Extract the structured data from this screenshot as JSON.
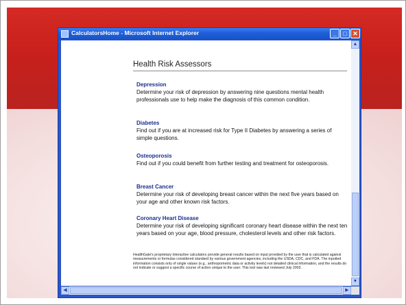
{
  "window": {
    "title": "CalculatorsHome - Microsoft Internet Explorer",
    "minimize_glyph": "_",
    "maximize_glyph": "□",
    "close_glyph": "✕"
  },
  "page": {
    "heading": "Health Risk Assessors",
    "items": [
      {
        "name": "Depression",
        "description": "Determine your risk of depression by answering nine questions mental health professionals use to help make the diagnosis of this common condition."
      },
      {
        "name": "Diabetes",
        "description": "Find out if you are at increased risk for Type II Diabetes by answering a series of simple questions."
      },
      {
        "name": "Osteoporosis",
        "description": "Find out if you could benefit from further testing and treatment for osteoporosis."
      },
      {
        "name": "Breast Cancer",
        "description": "Determine your risk of developing breast cancer within the next five years based on your age and other known risk factors."
      },
      {
        "name": "Coronary Heart Disease",
        "description": "Determine your risk of developing significant coronary heart disease within the next ten years based on your age, blood pressure, cholesterol levels and other risk factors."
      }
    ],
    "disclaimer": "HealthGate's proprietary interactive calculators provide general results based on input provided by the user that is calculated against measurements or formulas considered standard by various government agencies, including the USDA, CDC, and FDA. The inputted information consists only of single values (e.g., anthropometric data or activity levels) not detailed clinical information, and the results do not indicate or suggest a specific course of action unique to the user. This tool was last reviewed July 2003."
  },
  "scrollbars": {
    "up_arrow": "▲",
    "down_arrow": "▼",
    "left_arrow": "◀",
    "right_arrow": "▶"
  },
  "colors": {
    "slide_band": "#c8201c",
    "titlebar": "#1f5fd9",
    "link_heading": "#1a2e8c"
  }
}
